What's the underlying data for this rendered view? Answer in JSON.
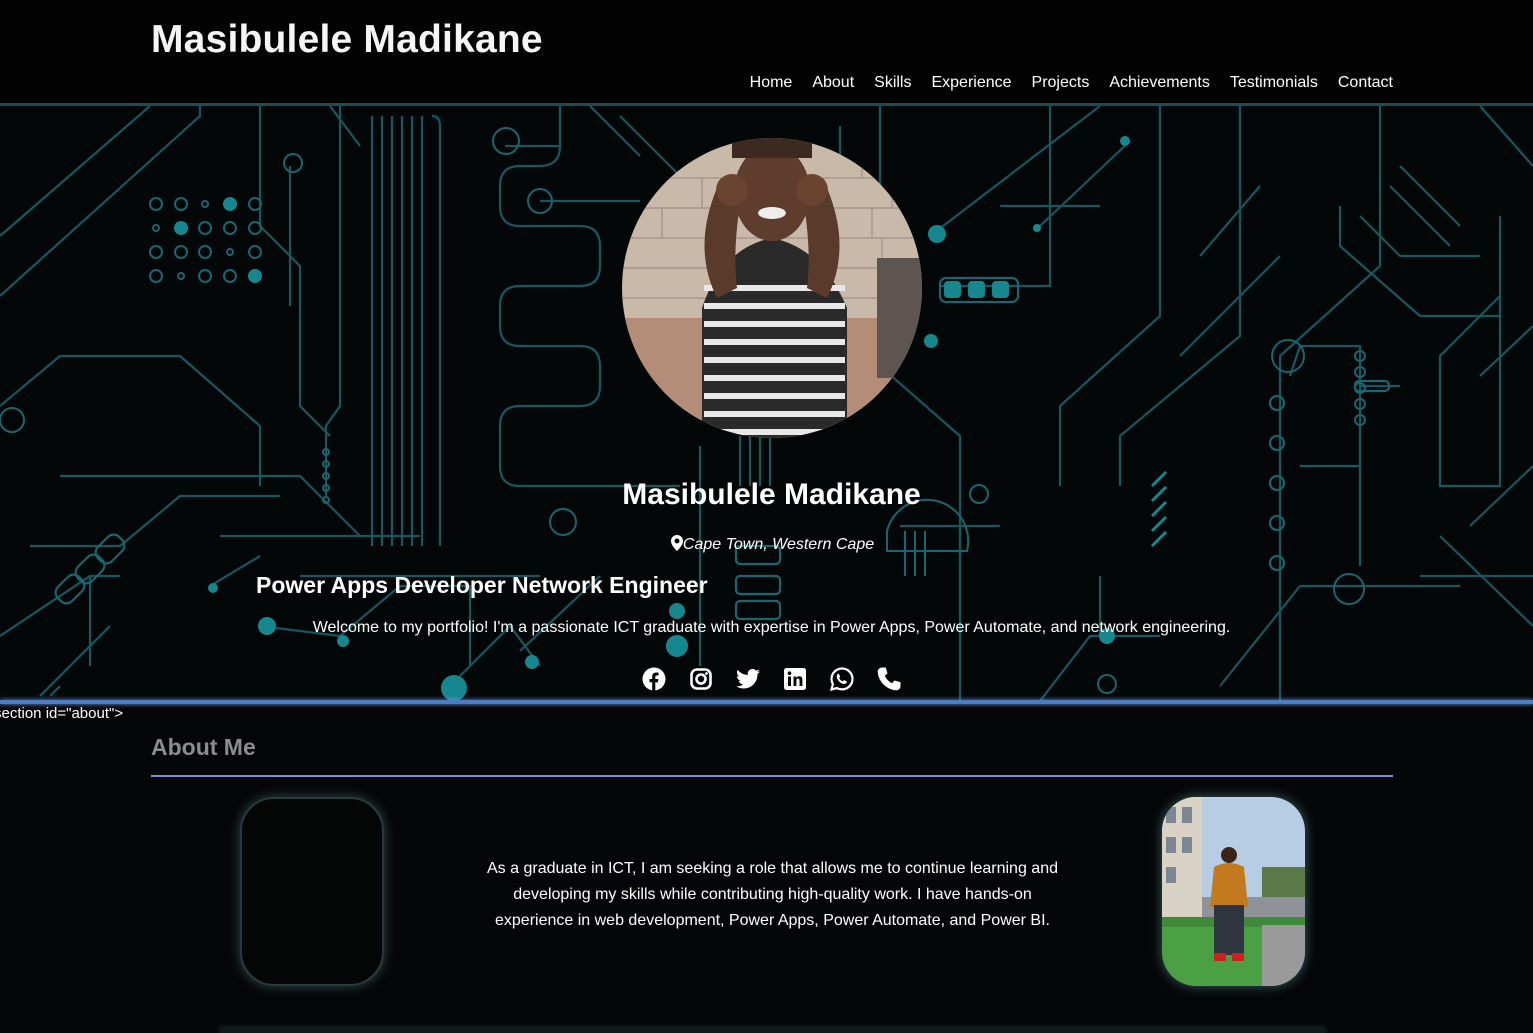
{
  "header": {
    "title": "Masibulele Madikane",
    "nav": [
      "Home",
      "About",
      "Skills",
      "Experience",
      "Projects",
      "Achievements",
      "Testimonials",
      "Contact"
    ]
  },
  "hero": {
    "name": "Masibulele Madikane",
    "location": "Cape Town, Western Cape",
    "role": "Power Apps Developer Network Engineer",
    "welcome": "Welcome to my portfolio! I'm a passionate ICT graduate with expertise in Power Apps, Power Automate, and network engineering.",
    "socials": [
      "facebook-icon",
      "instagram-icon",
      "twitter-icon",
      "linkedin-icon",
      "whatsapp-icon",
      "phone-icon"
    ]
  },
  "stray_text": "section id=\"about\">",
  "about": {
    "title": "About Me",
    "text": "As a graduate in ICT, I am seeking a role that allows me to continue learning and developing my skills while contributing high-quality work. I have hands-on experience in web development, Power Apps, Power Automate, and Power BI."
  },
  "colors": {
    "background": "#050607",
    "circuit": "#1c6f78",
    "accent_blue": "#6f96d8",
    "about_title": "#8c8c8c"
  }
}
